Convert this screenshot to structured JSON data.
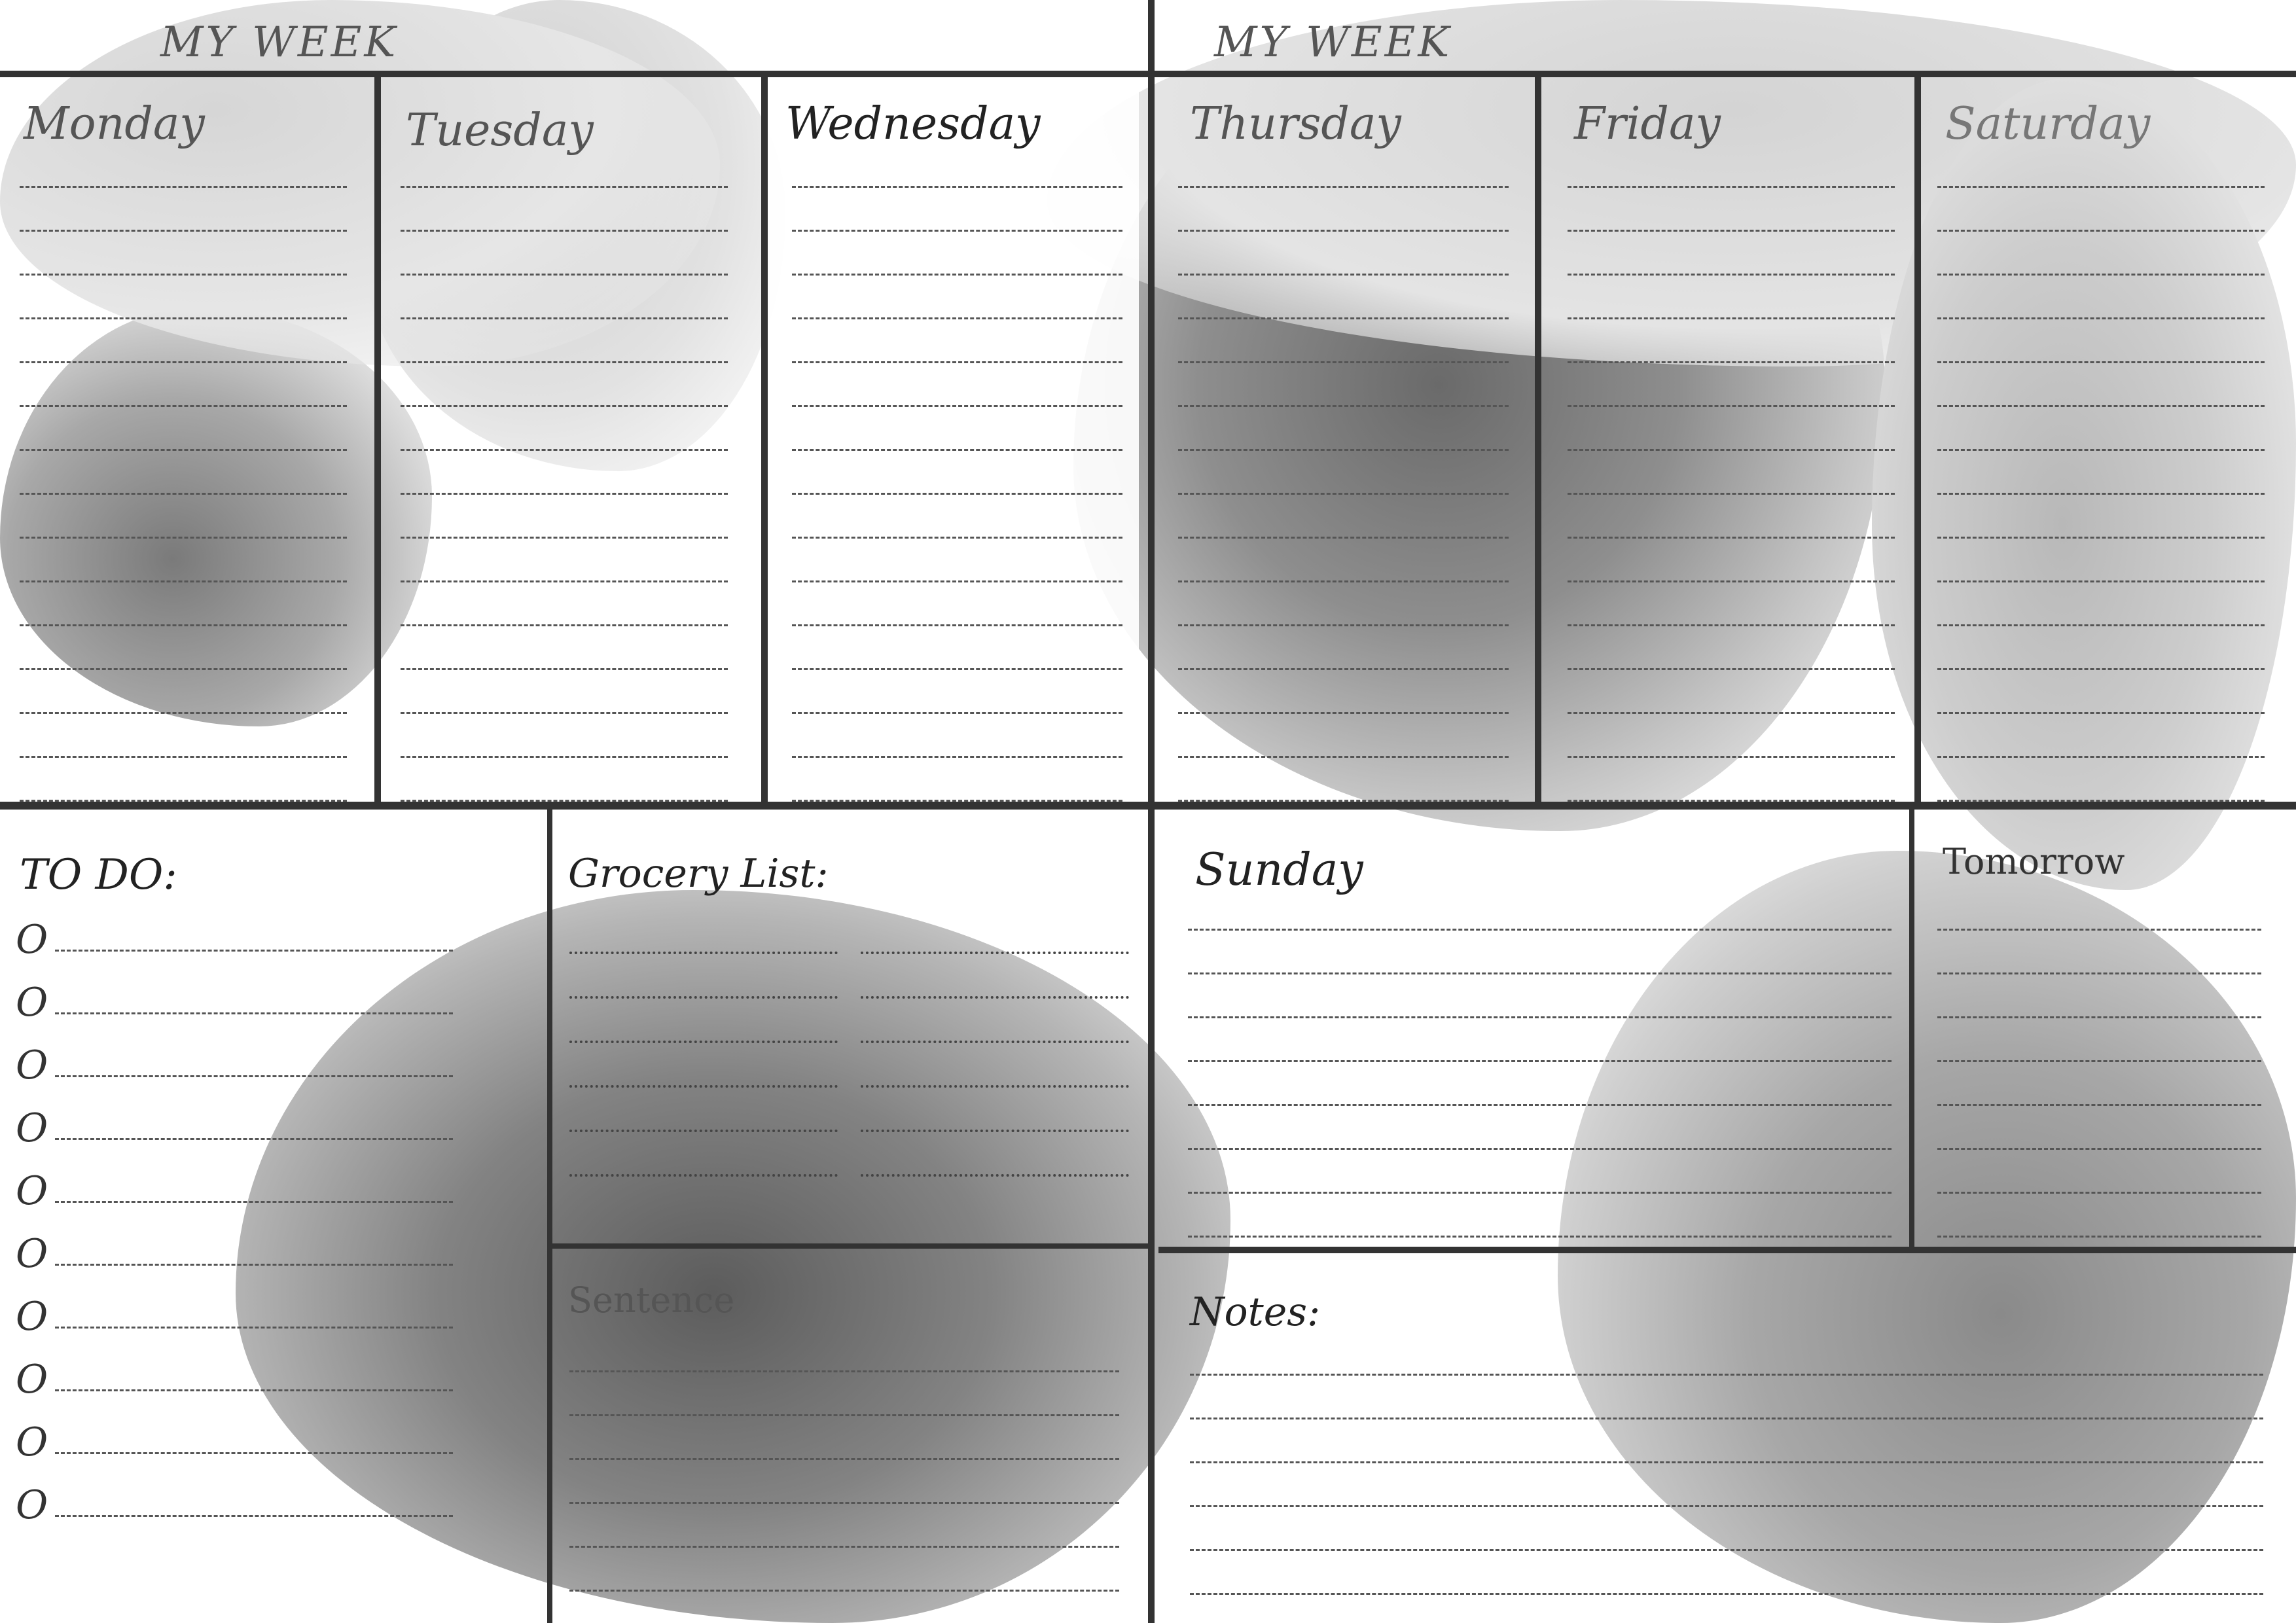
{
  "colors": {
    "ink": "#333333",
    "wash_dark": "#6f6f6f",
    "wash_mid": "#a9a9a9",
    "wash_light": "#d9d9d9",
    "paper": "#ffffff"
  },
  "header": {
    "left_title": "MY WEEK",
    "right_title": "MY WEEK"
  },
  "days": {
    "monday": "Monday",
    "tuesday": "Tuesday",
    "wednesday": "Wednesday",
    "thursday": "Thursday",
    "friday": "Friday",
    "saturday": "Saturday",
    "sunday": "Sunday",
    "tomorrow": "Tomorrow"
  },
  "todo": {
    "title": "TO DO:",
    "checkbox_glyph": "O",
    "items": [
      "",
      "",
      "",
      "",
      "",
      "",
      "",
      "",
      "",
      ""
    ]
  },
  "grocery": {
    "title": "Grocery List:"
  },
  "sentence": {
    "title": "Sentence"
  },
  "notes": {
    "title": "Notes:"
  }
}
